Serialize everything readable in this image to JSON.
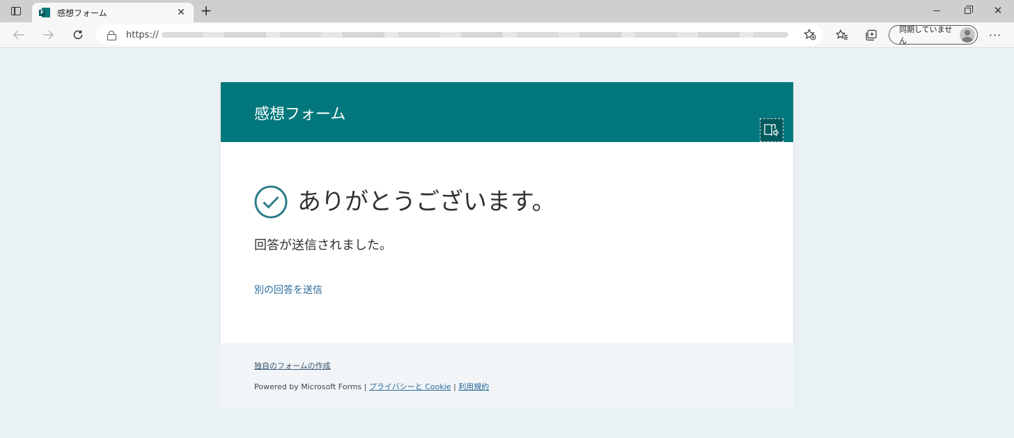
{
  "browser": {
    "tab_title": "感想フォーム",
    "tab_close": "✕",
    "new_tab": "+",
    "url_prefix": "https://",
    "profile_label": "同期していません",
    "more": "···"
  },
  "form": {
    "title": "感想フォーム",
    "thanks_title": "ありがとうございます。",
    "sent_message": "回答が送信されました。",
    "resubmit_link": "別の回答を送信"
  },
  "footer": {
    "create_link": "独自のフォームの作成",
    "powered_by": "Powered by Microsoft Forms",
    "separator": "|",
    "privacy_link": "プライバシーと Cookie",
    "terms_link": "利用規約"
  },
  "colors": {
    "header_teal": "#03787c",
    "check_teal": "#2d7d8a",
    "link_blue": "#2b6a9a",
    "page_background": "#e9f1f4"
  },
  "icons": {
    "tab_actions": "tab-actions-icon",
    "favicon": "forms-favicon-icon",
    "lock": "lock-icon",
    "favorites_add": "star-add-icon",
    "favorites": "favorites-icon",
    "collections": "collections-icon",
    "immersive_reader": "immersive-reader-icon",
    "check": "check-circle-icon"
  }
}
